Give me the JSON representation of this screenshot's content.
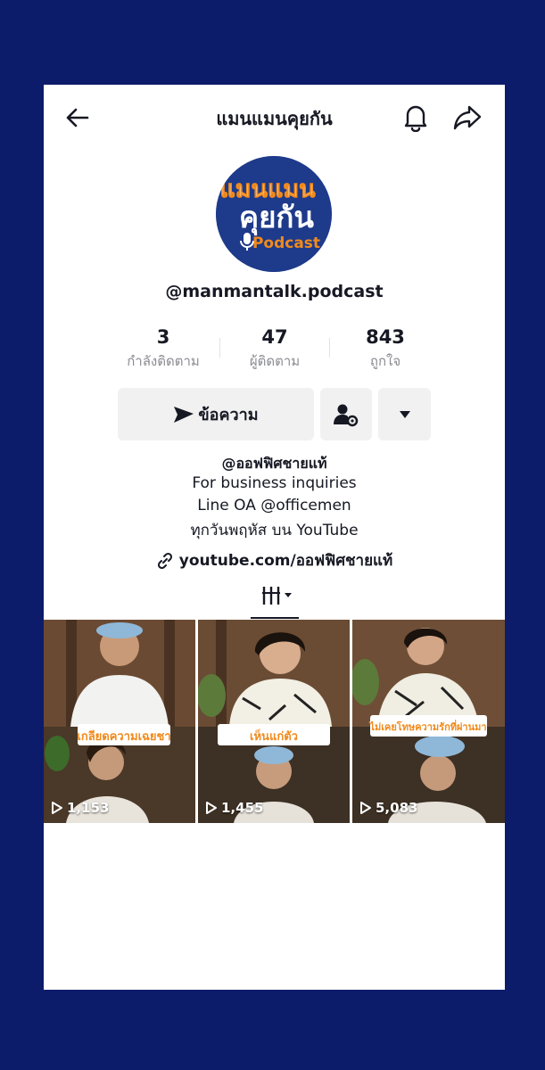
{
  "header": {
    "title": "แมนแมนคุยกัน",
    "back_icon": "arrow-left-icon",
    "bell_icon": "bell-icon",
    "share_icon": "share-arrow-icon"
  },
  "profile": {
    "avatar_text_top": "แมนแมน",
    "avatar_text_mid": "คุยกัน",
    "avatar_text_bottom": "Podcast",
    "handle": "@manmantalk.podcast"
  },
  "stats": [
    {
      "value": "3",
      "label": "กำลังติดตาม"
    },
    {
      "value": "47",
      "label": "ผู้ติดตาม"
    },
    {
      "value": "843",
      "label": "ถูกใจ"
    }
  ],
  "actions": {
    "message_label": "ข้อความ",
    "message_icon": "send-icon",
    "follow_icon": "person-settings-icon",
    "more_icon": "caret-down-icon"
  },
  "bio": {
    "line1": "@ออฟฟิศชายแท้",
    "line2": "For business inquiries",
    "line3": "Line OA @officemen",
    "line4": "ทุกวันพฤหัส บน YouTube",
    "link": "youtube.com/ออฟฟิศชายแท้",
    "link_icon": "link-icon"
  },
  "videos": [
    {
      "views": "1,153",
      "caption": "เกลียดความเฉยชา"
    },
    {
      "views": "1,455",
      "caption": "เห็นแก่ตัว"
    },
    {
      "views": "5,083",
      "caption": "ไม่เคยโทษความรักที่ผ่านมา"
    }
  ],
  "colors": {
    "background": "#0d1b6b",
    "accent_orange": "#f08a1c",
    "avatar_blue": "#1e3a8a"
  }
}
